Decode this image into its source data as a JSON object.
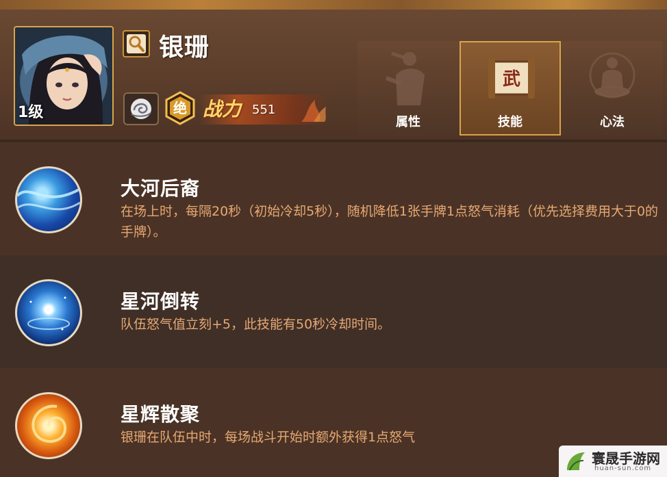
{
  "hero": {
    "name": "银珊",
    "level": "1级",
    "power_label": "战力",
    "power_value": "551",
    "rarity_glyph": "绝"
  },
  "tabs": [
    {
      "label": "属性",
      "icon": "figure-icon"
    },
    {
      "label": "技能",
      "icon": "scroll-icon",
      "glyph": "武"
    },
    {
      "label": "心法",
      "icon": "meditation-icon"
    }
  ],
  "skills": [
    {
      "name": "大河后裔",
      "desc": "在场上时，每隔20秒（初始冷却5秒），随机降低1张手牌1点怒气消耗（优先选择费用大于0的手牌）。",
      "icon": "river-icon"
    },
    {
      "name": "星河倒转",
      "desc": "队伍怒气值立刻+5，此技能有50秒冷却时间。",
      "icon": "star-orb-icon"
    },
    {
      "name": "星辉散聚",
      "desc": "银珊在队伍中时，每场战斗开始时额外获得1点怒气",
      "icon": "fire-swirl-icon"
    }
  ],
  "watermark": {
    "title": "寰晟手游网",
    "subtitle": "huan-sun.com"
  },
  "colors": {
    "accent_gold": "#d9a54a",
    "desc_text": "#e8a873",
    "row_light": "#4a3326",
    "row_dark": "#3f2f27"
  }
}
